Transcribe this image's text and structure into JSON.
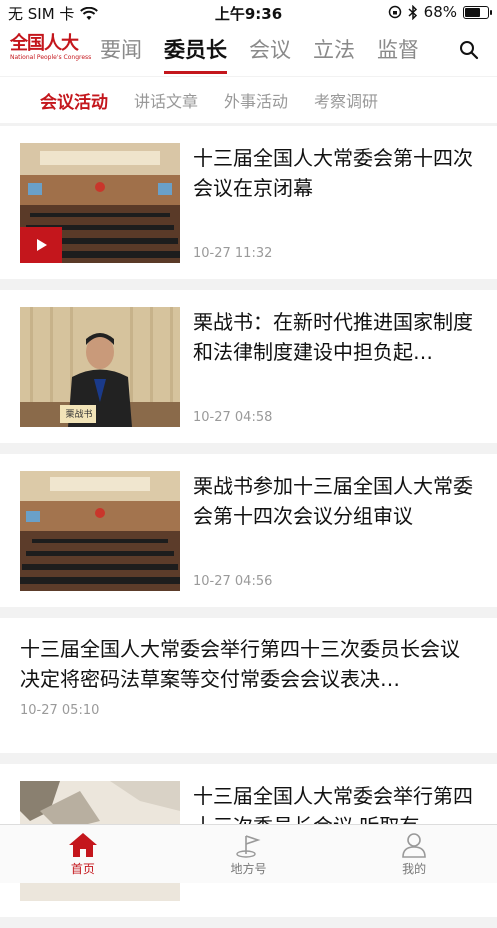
{
  "status_bar": {
    "carrier": "无 SIM 卡",
    "time": "上午9:36",
    "battery": "68%",
    "battery_fraction": 0.68
  },
  "header": {
    "logo_main": "全国人大",
    "logo_sub": "National People's Congress",
    "tabs": [
      "要闻",
      "委员长",
      "会议",
      "立法",
      "监督"
    ],
    "active_tab": "委员长"
  },
  "subtabs": [
    "会议活动",
    "讲话文章",
    "外事活动",
    "考察调研"
  ],
  "articles": [
    {
      "title": "十三届全国人大常委会第十四次会议在京闭幕",
      "time": "10-27 11:32"
    },
    {
      "title": "栗战书：在新时代推进国家制度和法律制度建设中担负起…",
      "time": "10-27 04:58"
    },
    {
      "title": "栗战书参加十三届全国人大常委会第十四次会议分组审议",
      "time": "10-27 04:56"
    },
    {
      "title": "十三届全国人大常委会举行第四十三次委员长会议 决定将密码法草案等交付常委会会议表决…",
      "time": "10-27 05:10"
    },
    {
      "title": "十三届全国人大常委会举行第四十三次委员长会议 听取有",
      "time": ""
    }
  ],
  "nameplate": "栗战书",
  "tabbar": [
    "首页",
    "地方号",
    "我的"
  ],
  "colors": {
    "accent": "#c4161c"
  }
}
